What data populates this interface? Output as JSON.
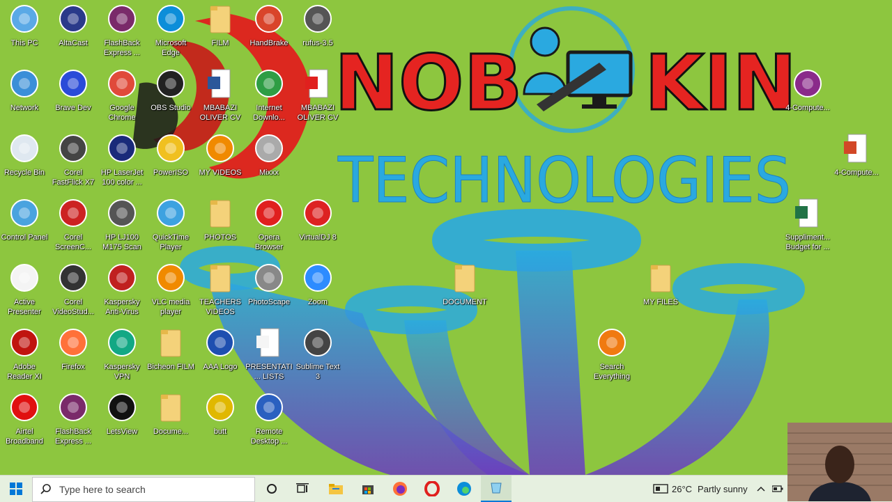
{
  "wallpaper": {
    "brand_line1_left": "NOB",
    "brand_line1_right": "KIN",
    "brand_line2": "TECHNOLOGIES"
  },
  "icons": [
    {
      "label": "This PC",
      "icon": "computer-icon"
    },
    {
      "label": "AltaCast",
      "icon": "altacast-icon"
    },
    {
      "label": "FlashBack Express ...",
      "icon": "flashback-icon"
    },
    {
      "label": "Microsoft Edge",
      "icon": "edge-icon"
    },
    {
      "label": "FILM",
      "icon": "folder-icon"
    },
    {
      "label": "HandBrake",
      "icon": "handbrake-icon"
    },
    {
      "label": "rufus-3.5",
      "icon": "usb-drive-icon"
    },
    {
      "label": "Network",
      "icon": "network-icon"
    },
    {
      "label": "Brave Dev",
      "icon": "brave-icon"
    },
    {
      "label": "Google Chrome",
      "icon": "chrome-icon"
    },
    {
      "label": "OBS Studio",
      "icon": "obs-icon"
    },
    {
      "label": "MBABAZI OLIVER CV",
      "icon": "word-document-icon"
    },
    {
      "label": "Internet Downlo...",
      "icon": "idm-icon"
    },
    {
      "label": "MBABAZI OLIVER CV",
      "icon": "pdf-icon"
    },
    {
      "label": "Recycle Bin",
      "icon": "recycle-bin-icon"
    },
    {
      "label": "Corel FastFlick X7",
      "icon": "corel-fastflick-icon"
    },
    {
      "label": "HP LaserJet 100 color ...",
      "icon": "hp-printer-icon"
    },
    {
      "label": "PowerISO",
      "icon": "poweriso-icon"
    },
    {
      "label": "MY VIDEOS",
      "icon": "vlc-folder-icon"
    },
    {
      "label": "Mixxx",
      "icon": "mixxx-icon"
    },
    {
      "label": "Control Panel",
      "icon": "control-panel-icon"
    },
    {
      "label": "Corel ScreenC...",
      "icon": "corel-screencap-icon"
    },
    {
      "label": "HP LJ100 M175 Scan",
      "icon": "scanner-icon"
    },
    {
      "label": "QuickTime Player",
      "icon": "quicktime-icon"
    },
    {
      "label": "PHOTOS",
      "icon": "folder-icon"
    },
    {
      "label": "Opera Browser",
      "icon": "opera-icon"
    },
    {
      "label": "VirtualDJ 8",
      "icon": "virtualdj-icon"
    },
    {
      "label": "Active Presenter",
      "icon": "activepresenter-icon"
    },
    {
      "label": "Corel VideoStud...",
      "icon": "corel-videostudio-icon"
    },
    {
      "label": "Kaspersky Anti-Virus",
      "icon": "kaspersky-icon"
    },
    {
      "label": "VLC media player",
      "icon": "vlc-icon"
    },
    {
      "label": "TEACHERS VIDEOS",
      "icon": "folder-icon"
    },
    {
      "label": "PhotoScape",
      "icon": "photoscape-icon"
    },
    {
      "label": "Zoom",
      "icon": "zoom-icon"
    },
    {
      "label": "DOCUMENT",
      "icon": "folder-icon"
    },
    {
      "label": "MY FILES",
      "icon": "folder-icon"
    },
    {
      "label": "Adobe Reader XI",
      "icon": "adobe-reader-icon"
    },
    {
      "label": "Firefox",
      "icon": "firefox-icon"
    },
    {
      "label": "Kaspersky VPN",
      "icon": "kaspersky-vpn-icon"
    },
    {
      "label": "Bicheon FILM",
      "icon": "folder-icon"
    },
    {
      "label": "AAA Logo",
      "icon": "aaa-logo-icon"
    },
    {
      "label": "PRESENTATI... LISTS",
      "icon": "text-document-icon"
    },
    {
      "label": "Sublime Text 3",
      "icon": "sublime-icon"
    },
    {
      "label": "Search Everything",
      "icon": "search-everything-icon"
    },
    {
      "label": "Airtel Broadband",
      "icon": "airtel-icon"
    },
    {
      "label": "FlashBack Express ...",
      "icon": "flashback-icon"
    },
    {
      "label": "LetsView",
      "icon": "letsview-icon"
    },
    {
      "label": "Docume...",
      "icon": "folder-icon"
    },
    {
      "label": "butt",
      "icon": "butt-icon"
    },
    {
      "label": "Remote Desktop ...",
      "icon": "remote-desktop-icon"
    },
    {
      "label": "4-Compute...",
      "icon": "winrar-icon"
    },
    {
      "label": "4-Compute...",
      "icon": "powerpoint-icon"
    },
    {
      "label": "Suppliment... Budget for ...",
      "icon": "excel-icon"
    }
  ],
  "taskbar": {
    "search_placeholder": "Type here to search",
    "weather_temp": "26°C",
    "weather_text": "Partly sunny"
  }
}
